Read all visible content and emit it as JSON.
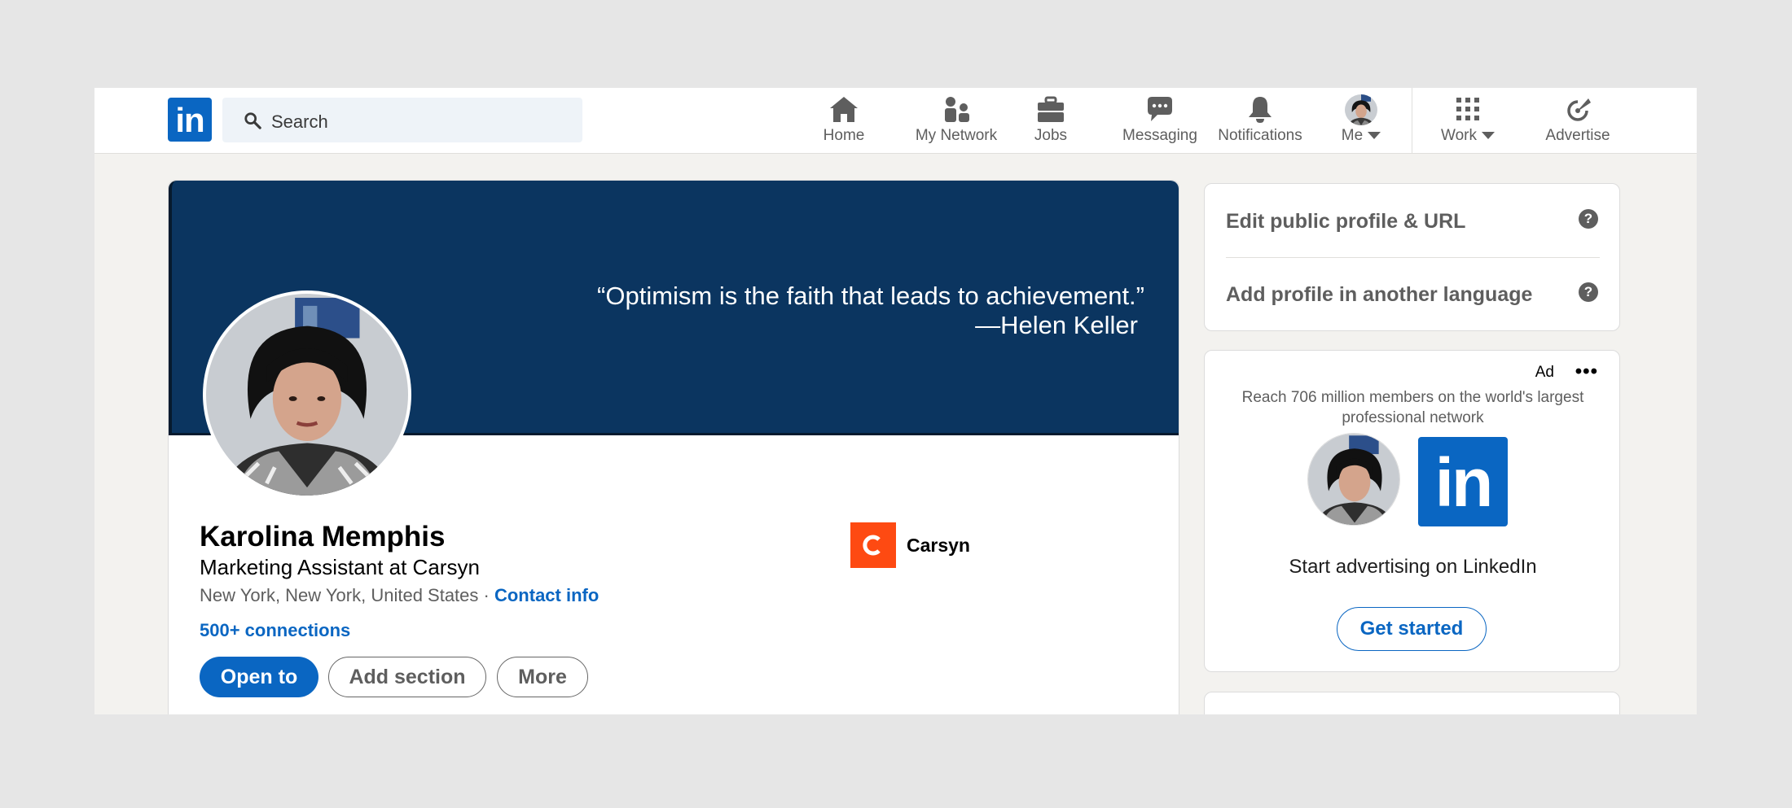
{
  "nav": {
    "logo": "in",
    "search_placeholder": "Search",
    "items": [
      {
        "label": "Home",
        "icon": "home-icon"
      },
      {
        "label": "My Network",
        "icon": "people-icon"
      },
      {
        "label": "Jobs",
        "icon": "briefcase-icon"
      },
      {
        "label": "Messaging",
        "icon": "chat-icon"
      },
      {
        "label": "Notifications",
        "icon": "bell-icon"
      },
      {
        "label": "Me",
        "icon": "avatar"
      },
      {
        "label": "Work",
        "icon": "grid-icon"
      },
      {
        "label": "Advertise",
        "icon": "compass-icon"
      }
    ]
  },
  "profile": {
    "banner_quote_line1": "“Optimism is the faith that leads to achievement.”",
    "banner_quote_line2": "—Helen Keller",
    "name": "Karolina Memphis",
    "headline": "Marketing Assistant at Carsyn",
    "location": "New York, New York, United States",
    "separator": " · ",
    "contact_info": "Contact info",
    "connections": "500+ connections",
    "company": {
      "name": "Carsyn",
      "logo_letter": "C",
      "color": "#fe4a12"
    },
    "buttons": {
      "open_to": "Open to",
      "add_section": "Add section",
      "more": "More"
    }
  },
  "rail": {
    "edit_public_profile": "Edit public profile & URL",
    "add_language": "Add profile in another language",
    "help_glyph": "?",
    "ad": {
      "tag": "Ad",
      "more": "•••",
      "text": "Reach 706 million members on the world's largest professional network",
      "logo": "in",
      "cta_text": "Start advertising on LinkedIn",
      "button": "Get started"
    }
  },
  "colors": {
    "brand": "#0a66c2",
    "banner": "#0b3560",
    "page_bg": "#f3f2ef"
  }
}
